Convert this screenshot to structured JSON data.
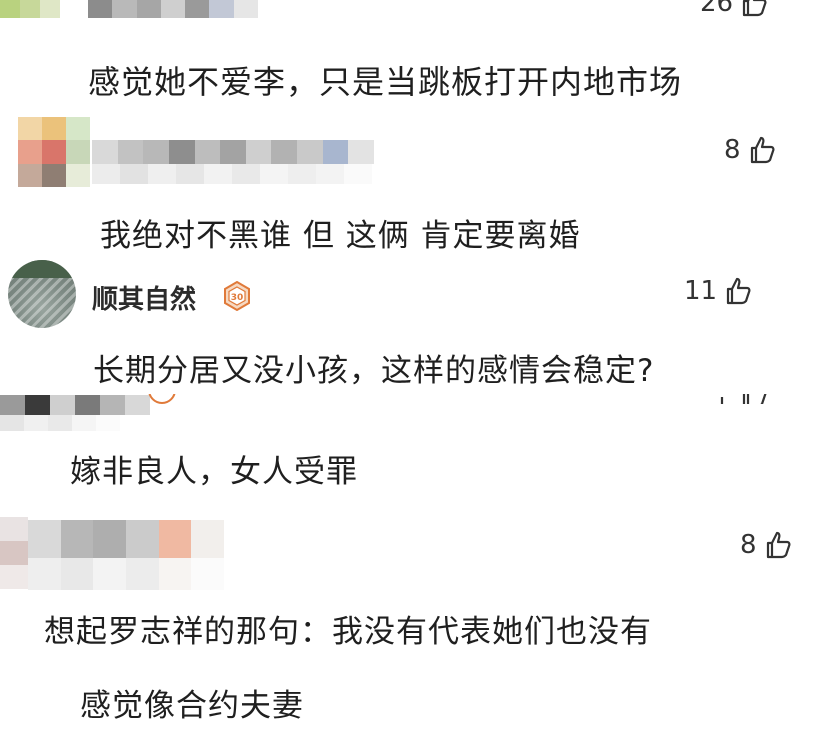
{
  "comments": [
    {
      "text": "感觉她不爱李，只是当跳板打开内地市场",
      "likes": "26"
    },
    {
      "text": "我绝对不黑谁 但 这俩 肯定要离婚",
      "likes": "8"
    },
    {
      "username": "顺其自然",
      "level_badge": "30",
      "text": "长期分居又没小孩，这样的感情会稳定?",
      "likes": "11"
    },
    {
      "text": "嫁非良人，女人受罪"
    },
    {
      "text_line1": "想起罗志祥的那句：我没有代表她们也没有",
      "likes": "8"
    },
    {
      "text": "感觉像合约夫妻"
    }
  ],
  "icons": {
    "like": "thumbs-up-icon",
    "level": "level-badge-icon"
  },
  "colors": {
    "text": "#1f1f1f",
    "badge": "#e07a3a",
    "background": "#ffffff"
  }
}
